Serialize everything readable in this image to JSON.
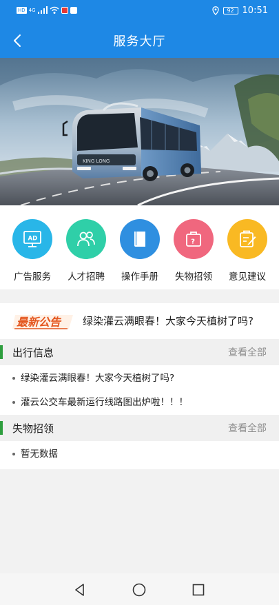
{
  "statusbar": {
    "network": "HD",
    "signal_label": "4G",
    "battery": "92",
    "time": "10:51"
  },
  "navbar": {
    "title": "服务大厅"
  },
  "banner": {
    "bus_brand": "KING LONG"
  },
  "quick_actions": [
    {
      "label": "广告服务",
      "icon": "ad-monitor-icon",
      "color": "#29b6e8",
      "icon_text": "AD"
    },
    {
      "label": "人才招聘",
      "icon": "people-icon",
      "color": "#2fcfa8"
    },
    {
      "label": "操作手册",
      "icon": "book-icon",
      "color": "#2f8fe0"
    },
    {
      "label": "失物招领",
      "icon": "luggage-icon",
      "color": "#f0677e",
      "icon_text": "?"
    },
    {
      "label": "意见建议",
      "icon": "feedback-icon",
      "color": "#f9b923"
    }
  ],
  "notice": {
    "tag": "最新公告",
    "text": "绿染灌云满眼春！大家今天植树了吗?"
  },
  "travel": {
    "title": "出行信息",
    "more": "查看全部",
    "items": [
      "绿染灌云满眼春！大家今天植树了吗?",
      "灌云公交车最新运行线路图出炉啦！！！"
    ]
  },
  "lost_found": {
    "title": "失物招领",
    "more": "查看全部",
    "items": [
      "暂无数据"
    ]
  },
  "colors": {
    "primary": "#1e88e5",
    "section_bar": "#2e9e3e"
  }
}
